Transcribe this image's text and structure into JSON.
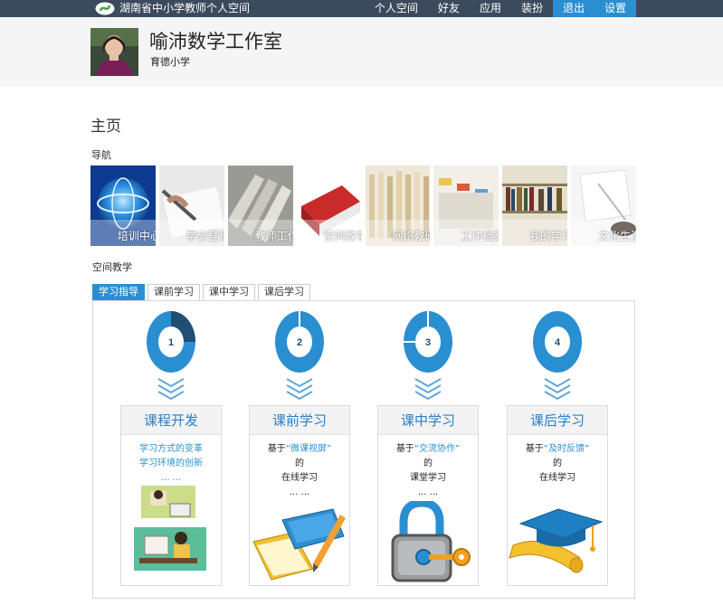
{
  "site": {
    "title": "湖南省中小学教师个人空间"
  },
  "topnav": [
    {
      "label": "个人空间"
    },
    {
      "label": "好友"
    },
    {
      "label": "应用"
    },
    {
      "label": "装扮"
    },
    {
      "label": "退出",
      "active": true
    },
    {
      "label": "设置",
      "active": true
    }
  ],
  "header": {
    "title": "喻沛数学工作室",
    "school": "育德小学"
  },
  "page": {
    "title": "主页"
  },
  "nav": {
    "label": "导航",
    "tiles": [
      {
        "label": "培训中心"
      },
      {
        "label": "学分登记"
      },
      {
        "label": "教师工作"
      },
      {
        "label": "空间教学"
      },
      {
        "label": "网络教研"
      },
      {
        "label": "工作档案"
      },
      {
        "label": "我的学习"
      },
      {
        "label": "文化生活"
      }
    ]
  },
  "teaching": {
    "label": "空间教学",
    "tabs": [
      {
        "label": "学习指导",
        "active": true
      },
      {
        "label": "课前学习"
      },
      {
        "label": "课中学习"
      },
      {
        "label": "课后学习"
      }
    ],
    "steps": [
      {
        "number": "1",
        "title": "课程开发",
        "lines": [
          {
            "text": "学习方式的变革",
            "cls": "blue"
          },
          {
            "text": "学习环境的创新",
            "cls": "blue"
          },
          {
            "text": "... ...",
            "cls": "blue"
          }
        ]
      },
      {
        "number": "2",
        "title": "课前学习",
        "lines": [
          {
            "pre": "基于",
            "hl": "“微课视屏”"
          },
          {
            "text": "的",
            "cls": "dark"
          },
          {
            "text": "在线学习",
            "cls": "dark"
          },
          {
            "text": "... ...",
            "cls": "dark"
          }
        ]
      },
      {
        "number": "3",
        "title": "课中学习",
        "lines": [
          {
            "pre": "基于",
            "hl": "“交流协作”"
          },
          {
            "text": "的",
            "cls": "dark"
          },
          {
            "text": "课堂学习",
            "cls": "dark"
          },
          {
            "text": "... ...",
            "cls": "dark"
          }
        ]
      },
      {
        "number": "4",
        "title": "课后学习",
        "lines": [
          {
            "pre": "基于",
            "hl": "“及时反馈”"
          },
          {
            "text": "的",
            "cls": "dark"
          },
          {
            "text": "在线学习",
            "cls": "dark"
          }
        ]
      }
    ]
  },
  "colors": {
    "topbar": "#3b4a5c",
    "accent": "#2a8fd1",
    "ring_dark": "#1f4f73"
  }
}
